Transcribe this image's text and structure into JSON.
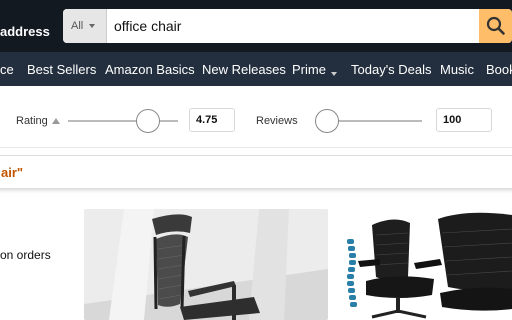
{
  "header": {
    "address_label": "address",
    "search_category": "All",
    "search_query": "office chair"
  },
  "nav": {
    "items": [
      "ce",
      "Best Sellers",
      "Amazon Basics",
      "New Releases",
      "Prime",
      "Today's Deals",
      "Music",
      "Book"
    ]
  },
  "filters": {
    "rating_label": "Rating",
    "rating_value": "4.75",
    "rating_level_fraction": 0.73,
    "reviews_label": "Reviews",
    "reviews_value": "100",
    "reviews_level_fraction": 0.0
  },
  "results": {
    "query_fragment": "air\""
  },
  "sidebar": {
    "shipping_text": "on orders"
  },
  "colors": {
    "header_bg": "#131921",
    "nav_bg": "#232f3e",
    "search_button": "#febd69",
    "results_accent": "#c45500"
  }
}
